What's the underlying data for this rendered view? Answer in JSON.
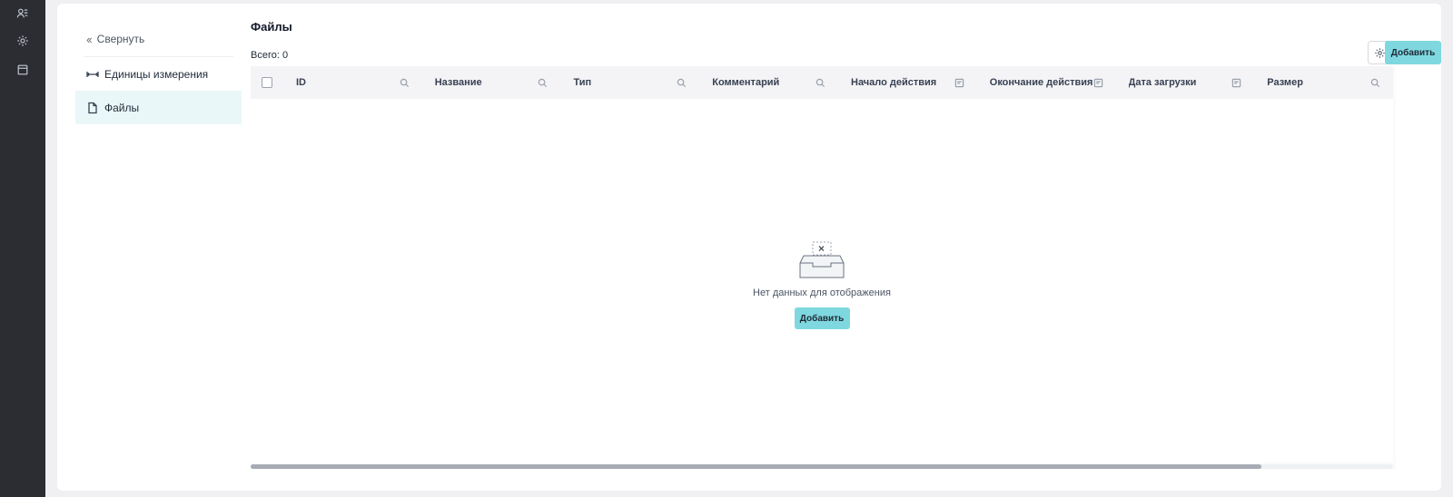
{
  "rail": {
    "icons": [
      "users-icon",
      "gear-icon",
      "calendar-icon"
    ]
  },
  "sidebar": {
    "collapse_label": "Свернуть",
    "items": [
      {
        "label": "Единицы измерения",
        "icon": "ruler-icon",
        "active": false
      },
      {
        "label": "Файлы",
        "icon": "file-icon",
        "active": true
      }
    ]
  },
  "main": {
    "title": "Файлы",
    "total_text": "Всего: 0",
    "add_label": "Добавить",
    "columns": [
      {
        "label": "ID",
        "filter_icon": "search-icon"
      },
      {
        "label": "Название",
        "filter_icon": "search-icon"
      },
      {
        "label": "Тип",
        "filter_icon": "search-icon"
      },
      {
        "label": "Комментарий",
        "filter_icon": "search-icon"
      },
      {
        "label": "Начало действия",
        "filter_icon": "calendar-filter-icon"
      },
      {
        "label": "Окончание действия",
        "filter_icon": "calendar-filter-icon"
      },
      {
        "label": "Дата загрузки",
        "filter_icon": "calendar-filter-icon"
      },
      {
        "label": "Размер",
        "filter_icon": "search-icon"
      }
    ],
    "empty_text": "Нет данных для отображения",
    "empty_add_label": "Добавить",
    "scroll_fraction": 0.885
  },
  "colors": {
    "accent": "#7fd8df",
    "rail_bg": "#2b2d33",
    "active_item_bg": "#eaf7f8"
  }
}
